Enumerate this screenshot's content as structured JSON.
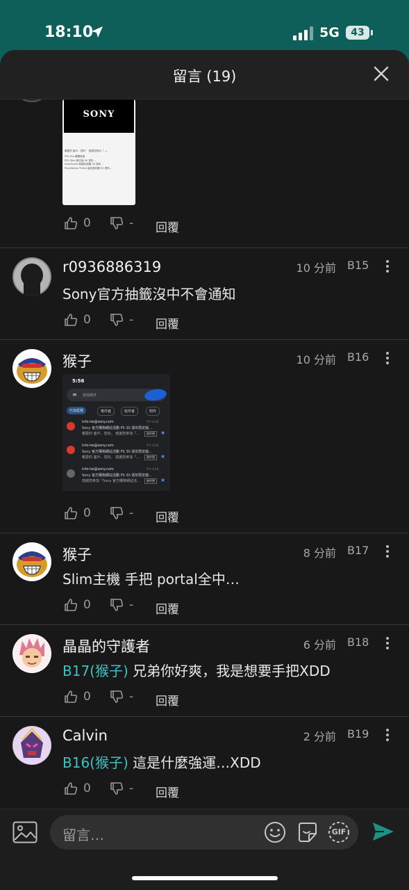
{
  "status": {
    "time": "18:10",
    "network": "5G",
    "battery": "43"
  },
  "header": {
    "title": "留言 (19)"
  },
  "top_comment": {
    "image": {
      "brand": "SONY",
      "lines": [
        "親愛的 客戶：您好！ 感謝您參加「…」",
        "PS5 Pro 預購資格",
        "PS5 Slim 數位版 30 週年…",
        "DualSense 無線控制器 30 週年…",
        "PlayStation Portal 遙控遊玩器 30 週年…"
      ]
    },
    "likes": "0",
    "dislikes": "-",
    "reply": "回覆"
  },
  "comments": [
    {
      "name": "r0936886319",
      "time": "10 分前",
      "floor": "B15",
      "text": "Sony官方抽籤沒中不會通知",
      "likes": "0",
      "dislikes": "-",
      "reply": "回覆"
    },
    {
      "name": "猴子",
      "time": "10 分前",
      "floor": "B16",
      "image": {
        "time": "5:56",
        "search": "搜尋郵件",
        "filter": "已加星號",
        "chips": [
          "寄件者",
          "收件者",
          "附件"
        ],
        "mails": [
          {
            "sender": "info-tw@sony.com",
            "time": "下午 4:32",
            "line1": "Sony 官方購物網站活動 PS 30 週年限定版…",
            "line2": "親愛的 客戶，您好， 感謝您參加「…",
            "tag": "收件匣"
          },
          {
            "sender": "info-tw@sony.com",
            "time": "下午 4:25",
            "line1": "Sony 官方購物網站活動 PS 30 週年限定版…",
            "line2": "親愛的 客戶，您好， 感謝您參加「…",
            "tag": "收件匣"
          },
          {
            "sender": "info-tw@sony.com",
            "time": "下午 4:10",
            "line1": "Sony 官方購物網站活動 PS 30 週年限定版…",
            "line2": "感謝您參加「Sony 官方購物網站活…",
            "tag": "收件匣"
          }
        ]
      },
      "likes": "0",
      "dislikes": "-",
      "reply": "回覆"
    },
    {
      "name": "猴子",
      "time": "8 分前",
      "floor": "B17",
      "text": "Slim主機 手把 portal全中…",
      "likes": "0",
      "dislikes": "-",
      "reply": "回覆"
    },
    {
      "name": "晶晶的守護者",
      "time": "6 分前",
      "floor": "B18",
      "mention": "B17(猴子)",
      "text": "兄弟你好爽，我是想要手把XDD",
      "likes": "0",
      "dislikes": "-",
      "reply": "回覆"
    },
    {
      "name": "Calvin",
      "time": "2 分前",
      "floor": "B19",
      "mention": "B16(猴子)",
      "text": "這是什麼強運…XDD",
      "likes": "0",
      "dislikes": "-",
      "reply": "回覆"
    }
  ],
  "composer": {
    "placeholder": "留言…",
    "gif": "GIF"
  },
  "colors": {
    "accent": "#3fc2c0",
    "background": "#181818",
    "status_bar": "#0e5f5a"
  }
}
